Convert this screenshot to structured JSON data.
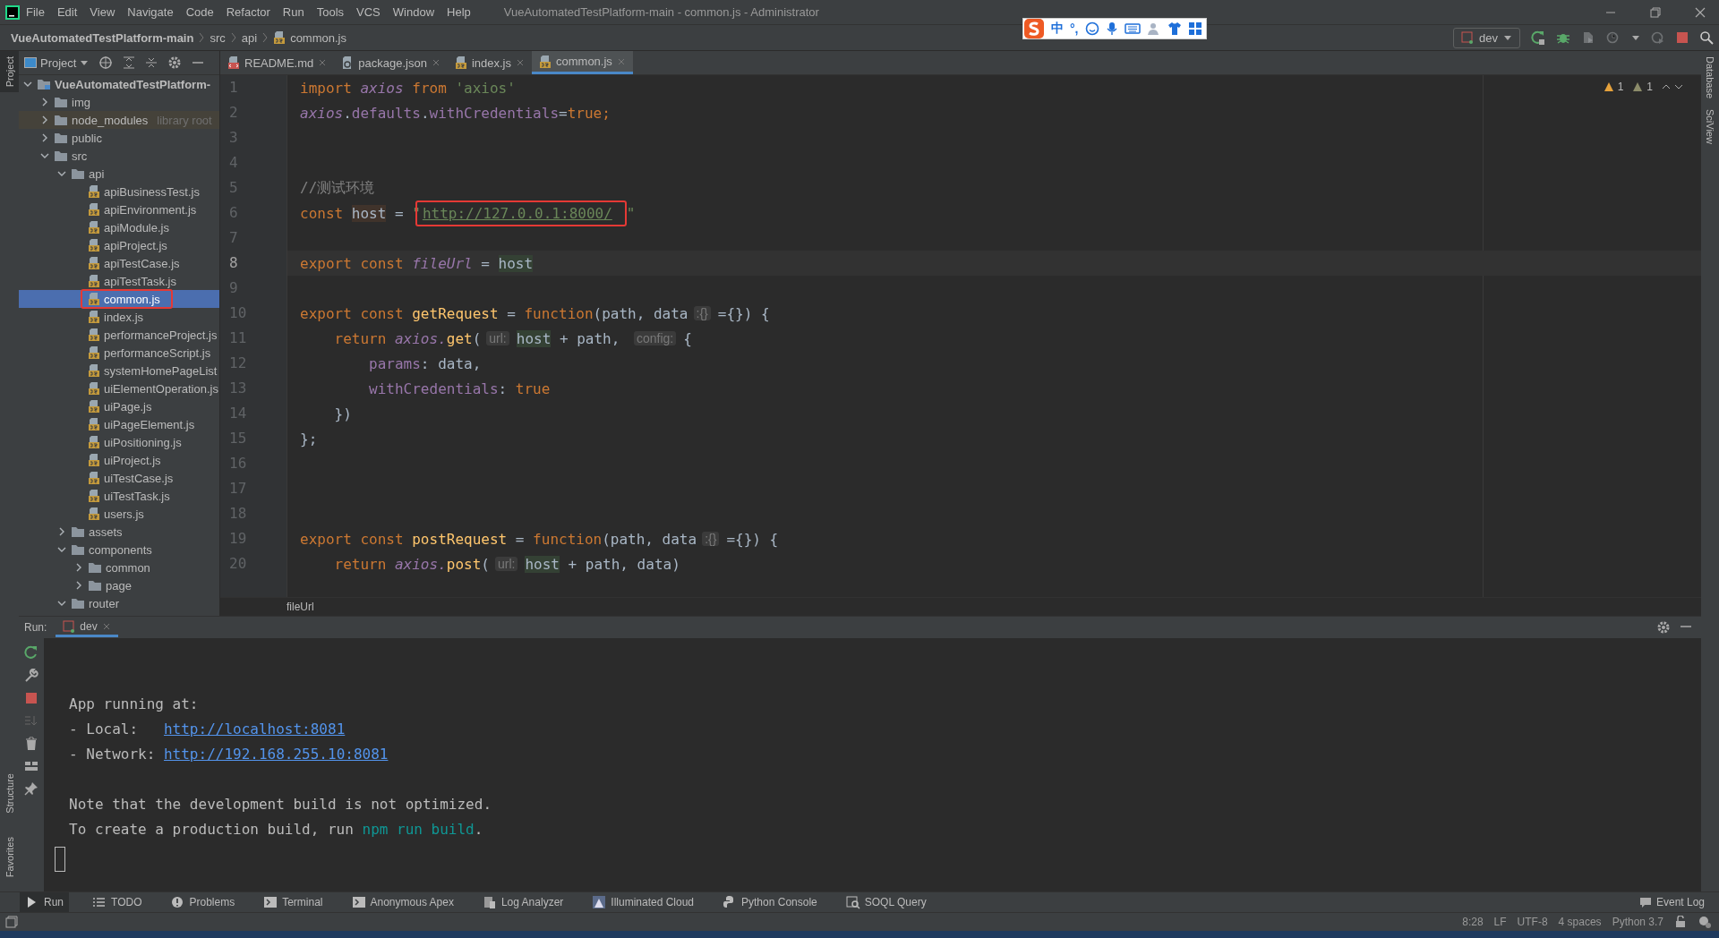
{
  "menu": [
    "File",
    "Edit",
    "View",
    "Navigate",
    "Code",
    "Refactor",
    "Run",
    "Tools",
    "VCS",
    "Window",
    "Help"
  ],
  "window": {
    "title": "VueAutomatedTestPlatform-main - common.js - Administrator"
  },
  "ime_toolbar": {
    "items": [
      "中",
      "°,"
    ]
  },
  "breadcrumb": [
    {
      "label": "VueAutomatedTestPlatform-main",
      "kind": "project"
    },
    {
      "label": "src",
      "kind": "folder"
    },
    {
      "label": "api",
      "kind": "folder"
    },
    {
      "label": "common.js",
      "kind": "file"
    }
  ],
  "run_config": {
    "label": "dev"
  },
  "left_stripe": [
    {
      "label": "Project",
      "selected": true
    },
    {
      "label": "Structure",
      "selected": false
    },
    {
      "label": "Favorites",
      "selected": false
    }
  ],
  "right_stripe": [
    "Database",
    "SciView"
  ],
  "project_panel": {
    "title": "Project"
  },
  "tree": [
    {
      "label": "VueAutomatedTestPlatform-",
      "kind": "project",
      "expanded": true,
      "selected": false,
      "children": [
        {
          "label": "img",
          "kind": "folder",
          "expanded": false,
          "selected": false
        },
        {
          "label": "node_modules",
          "kind": "library",
          "hint": "library root",
          "expanded": false,
          "selected": false
        },
        {
          "label": "public",
          "kind": "folder",
          "expanded": false,
          "selected": false
        },
        {
          "label": "src",
          "kind": "folder",
          "expanded": true,
          "selected": false,
          "children": [
            {
              "label": "api",
              "kind": "folder",
              "expanded": true,
              "selected": false,
              "children": [
                {
                  "label": "apiBusinessTest.js",
                  "kind": "file",
                  "selected": false
                },
                {
                  "label": "apiEnvironment.js",
                  "kind": "file",
                  "selected": false
                },
                {
                  "label": "apiModule.js",
                  "kind": "file",
                  "selected": false
                },
                {
                  "label": "apiProject.js",
                  "kind": "file",
                  "selected": false
                },
                {
                  "label": "apiTestCase.js",
                  "kind": "file",
                  "selected": false
                },
                {
                  "label": "apiTestTask.js",
                  "kind": "file",
                  "selected": false
                },
                {
                  "label": "common.js",
                  "kind": "file",
                  "selected": true,
                  "annotated": true
                },
                {
                  "label": "index.js",
                  "kind": "file",
                  "selected": false
                },
                {
                  "label": "performanceProject.js",
                  "kind": "file",
                  "selected": false
                },
                {
                  "label": "performanceScript.js",
                  "kind": "file",
                  "selected": false
                },
                {
                  "label": "systemHomePageList",
                  "kind": "file",
                  "selected": false
                },
                {
                  "label": "uiElementOperation.js",
                  "kind": "file",
                  "selected": false
                },
                {
                  "label": "uiPage.js",
                  "kind": "file",
                  "selected": false
                },
                {
                  "label": "uiPageElement.js",
                  "kind": "file",
                  "selected": false
                },
                {
                  "label": "uiPositioning.js",
                  "kind": "file",
                  "selected": false
                },
                {
                  "label": "uiProject.js",
                  "kind": "file",
                  "selected": false
                },
                {
                  "label": "uiTestCase.js",
                  "kind": "file",
                  "selected": false
                },
                {
                  "label": "uiTestTask.js",
                  "kind": "file",
                  "selected": false
                },
                {
                  "label": "users.js",
                  "kind": "file",
                  "selected": false
                }
              ]
            },
            {
              "label": "assets",
              "kind": "folder",
              "expanded": false,
              "selected": false
            },
            {
              "label": "components",
              "kind": "folder",
              "expanded": true,
              "selected": false,
              "children": [
                {
                  "label": "common",
                  "kind": "folder",
                  "expanded": false,
                  "selected": false
                },
                {
                  "label": "page",
                  "kind": "folder",
                  "expanded": false,
                  "selected": false
                }
              ]
            },
            {
              "label": "router",
              "kind": "folder",
              "expanded": true,
              "selected": false
            }
          ]
        }
      ]
    }
  ],
  "tabs": [
    {
      "label": "README.md",
      "kind": "markdown",
      "selected": false
    },
    {
      "label": "package.json",
      "kind": "json",
      "selected": false
    },
    {
      "label": "index.js",
      "kind": "js",
      "selected": false
    },
    {
      "label": "common.js",
      "kind": "js",
      "selected": true
    }
  ],
  "inspections": [
    {
      "kind": "warning",
      "count": "1"
    },
    {
      "kind": "weak",
      "count": "1"
    }
  ],
  "code": [
    {
      "number": "1",
      "current": false,
      "tokens": [
        {
          "kind": "kw",
          "text": "import "
        },
        {
          "kind": "var",
          "text": "axios"
        },
        {
          "kind": "kw",
          "text": " from "
        },
        {
          "kind": "str",
          "text": "'axios'"
        }
      ]
    },
    {
      "number": "2",
      "current": false,
      "tokens": [
        {
          "kind": "var",
          "text": "axios"
        },
        {
          "kind": "p",
          "text": "."
        },
        {
          "kind": "prop",
          "text": "defaults"
        },
        {
          "kind": "p",
          "text": "."
        },
        {
          "kind": "prop",
          "text": "withCredentials"
        },
        {
          "kind": "p",
          "text": "="
        },
        {
          "kind": "kw",
          "text": "true;"
        }
      ]
    },
    {
      "number": "3",
      "current": false
    },
    {
      "number": "4",
      "current": false
    },
    {
      "number": "5",
      "current": false,
      "tokens": [
        {
          "kind": "comment",
          "text": "//测试环境"
        }
      ]
    },
    {
      "number": "6",
      "current": false,
      "tokens": [
        {
          "kind": "kw",
          "text": "const "
        },
        {
          "kind": "write",
          "text": "host"
        },
        {
          "kind": "p",
          "text": " = "
        },
        {
          "kind": "str",
          "text": "\""
        },
        {
          "kind": "url",
          "text": "http://127.0.0.1:8000/",
          "boxed": true
        },
        {
          "kind": "str",
          "text": "\""
        }
      ]
    },
    {
      "number": "7",
      "current": false
    },
    {
      "number": "8",
      "current": true,
      "tokens": [
        {
          "kind": "kw",
          "text": "export const "
        },
        {
          "kind": "var",
          "text": "fileUrl"
        },
        {
          "kind": "p",
          "text": " = "
        },
        {
          "kind": "read",
          "text": "host"
        }
      ]
    },
    {
      "number": "9",
      "current": false
    },
    {
      "number": "10",
      "current": false,
      "tokens": [
        {
          "kind": "kw",
          "text": "export const "
        },
        {
          "kind": "func",
          "text": "getRequest"
        },
        {
          "kind": "p",
          "text": " = "
        },
        {
          "kind": "kw",
          "text": "function"
        },
        {
          "kind": "p",
          "text": "(path, data"
        },
        {
          "kind": "hint",
          "text": ":{}"
        },
        {
          "kind": "p",
          "text": "={}) {"
        }
      ]
    },
    {
      "number": "11",
      "current": false,
      "tokens": [
        {
          "kind": "kw",
          "text": "    return "
        },
        {
          "kind": "var",
          "text": "axios."
        },
        {
          "kind": "func",
          "text": "get"
        },
        {
          "kind": "p",
          "text": "("
        },
        {
          "kind": "hint",
          "text": "url:"
        },
        {
          "kind": "read",
          "text": "host"
        },
        {
          "kind": "p",
          "text": " + path, "
        },
        {
          "kind": "hint",
          "text": "config:"
        },
        {
          "kind": "p",
          "text": "{"
        }
      ]
    },
    {
      "number": "12",
      "current": false,
      "tokens": [
        {
          "kind": "prop",
          "text": "        params"
        },
        {
          "kind": "p",
          "text": ": data,"
        }
      ]
    },
    {
      "number": "13",
      "current": false,
      "tokens": [
        {
          "kind": "prop",
          "text": "        withCredentials"
        },
        {
          "kind": "p",
          "text": ": "
        },
        {
          "kind": "kw",
          "text": "true"
        }
      ]
    },
    {
      "number": "14",
      "current": false,
      "tokens": [
        {
          "kind": "p",
          "text": "    })"
        }
      ]
    },
    {
      "number": "15",
      "current": false,
      "tokens": [
        {
          "kind": "p",
          "text": "};"
        }
      ]
    },
    {
      "number": "16",
      "current": false
    },
    {
      "number": "17",
      "current": false
    },
    {
      "number": "18",
      "current": false
    },
    {
      "number": "19",
      "current": false,
      "tokens": [
        {
          "kind": "kw",
          "text": "export const "
        },
        {
          "kind": "func",
          "text": "postRequest"
        },
        {
          "kind": "p",
          "text": " = "
        },
        {
          "kind": "kw",
          "text": "function"
        },
        {
          "kind": "p",
          "text": "(path, data"
        },
        {
          "kind": "hint",
          "text": ":{}"
        },
        {
          "kind": "p",
          "text": "={}) {"
        }
      ]
    },
    {
      "number": "20",
      "current": false,
      "tokens": [
        {
          "kind": "kw",
          "text": "    return "
        },
        {
          "kind": "var",
          "text": "axios."
        },
        {
          "kind": "func",
          "text": "post"
        },
        {
          "kind": "p",
          "text": "("
        },
        {
          "kind": "hint",
          "text": "url:"
        },
        {
          "kind": "read",
          "text": "host"
        },
        {
          "kind": "p",
          "text": " + path, data)"
        }
      ]
    }
  ],
  "editor_breadcrumb": "fileUrl",
  "run_panel": {
    "label": "Run:",
    "tab": "dev",
    "console": [
      {
        "kind": "blank"
      },
      {
        "kind": "text",
        "tokens": [
          {
            "kind": "p",
            "text": "App running at:"
          }
        ]
      },
      {
        "kind": "text",
        "tokens": [
          {
            "kind": "p",
            "text": "- Local:   "
          },
          {
            "kind": "link",
            "text": "http://localhost:8081"
          }
        ]
      },
      {
        "kind": "text",
        "tokens": [
          {
            "kind": "p",
            "text": "- Network: "
          },
          {
            "kind": "link",
            "text": "http://192.168.255.10:8081"
          }
        ]
      },
      {
        "kind": "blank"
      },
      {
        "kind": "text",
        "tokens": [
          {
            "kind": "p",
            "text": "Note that the development build is not optimized."
          }
        ]
      },
      {
        "kind": "text",
        "tokens": [
          {
            "kind": "p",
            "text": "To create a production build, run "
          },
          {
            "kind": "cmd",
            "text": "npm run build"
          },
          {
            "kind": "p",
            "text": "."
          }
        ]
      }
    ]
  },
  "tool_windows": [
    {
      "label": "Run",
      "kind": "run",
      "selected": true
    },
    {
      "label": "TODO",
      "kind": "list",
      "selected": false
    },
    {
      "label": "Problems",
      "kind": "info",
      "selected": false
    },
    {
      "label": "Terminal",
      "kind": "terminal",
      "selected": false
    },
    {
      "label": "Anonymous Apex",
      "kind": "terminal",
      "selected": false
    },
    {
      "label": "Log Analyzer",
      "kind": "doc",
      "selected": false
    },
    {
      "label": "Illuminated Cloud",
      "kind": "cloud",
      "selected": false
    },
    {
      "label": "Python Console",
      "kind": "python",
      "selected": false
    },
    {
      "label": "SOQL Query",
      "kind": "query",
      "selected": false
    }
  ],
  "event_log": "Event Log",
  "status_bar": [
    "8:28",
    "LF",
    "UTF-8",
    "4 spaces",
    "Python 3.7"
  ]
}
